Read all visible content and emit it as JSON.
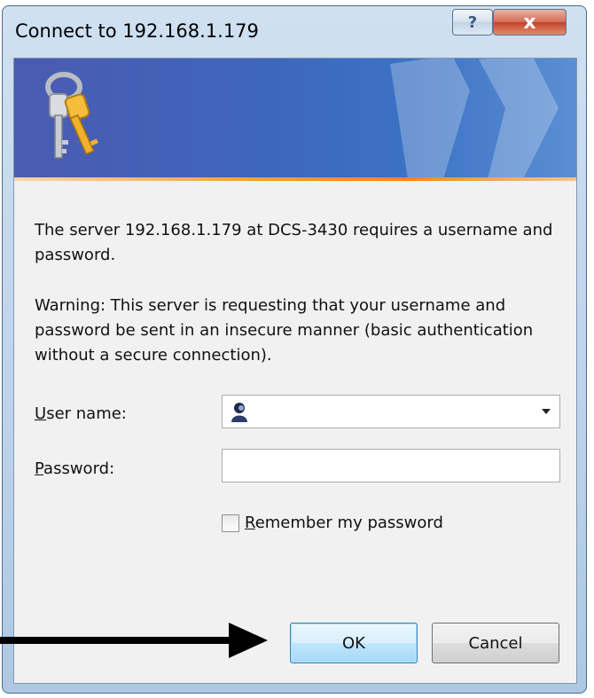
{
  "window": {
    "title": "Connect to 192.168.1.179",
    "help_label": "?",
    "close_label": "x"
  },
  "banner": {
    "icon": "keys-icon"
  },
  "message": {
    "line1": "The server 192.168.1.179 at DCS-3430 requires a username and password.",
    "line2": "Warning: This server is requesting that your username and password be sent in an insecure manner (basic authentication without a secure connection)."
  },
  "form": {
    "username_label_first": "U",
    "username_label_rest": "ser name:",
    "username_value": "",
    "username_icon": "user-icon",
    "password_label_first": "P",
    "password_label_rest": "assword:",
    "password_value": "",
    "remember_label_first": "R",
    "remember_label_rest": "emember my password",
    "remember_checked": false
  },
  "buttons": {
    "ok_label": "OK",
    "cancel_label": "Cancel"
  },
  "annotation": {
    "icon": "pointer-arrow-icon"
  },
  "colors": {
    "banner": "#3e66bb",
    "banner_line": "#f2862a",
    "close_button": "#c4432a",
    "ok_border": "#3c7fb1"
  }
}
